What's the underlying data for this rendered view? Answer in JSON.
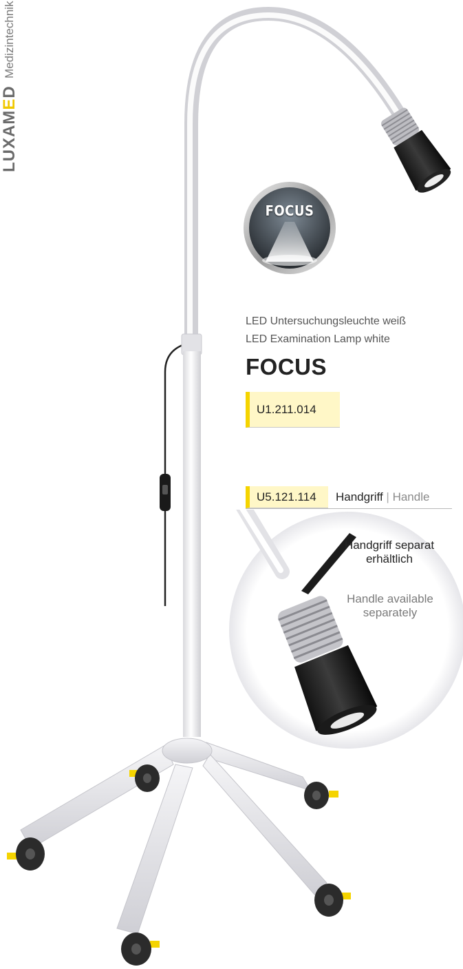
{
  "brand": {
    "logo_main": "LUXAM",
    "logo_accent": "E",
    "logo_tail": "D",
    "tagline": "Medizintechnik Made in Germany"
  },
  "badge": {
    "label": "FOCUS"
  },
  "product": {
    "desc_de": "LED Untersuchungsleuchte weiß",
    "desc_en": "LED Examination Lamp white",
    "name": "FOCUS",
    "code": "U1.211.014"
  },
  "accessory": {
    "code": "U5.121.114",
    "label_de": "Handgriff",
    "separator": " | ",
    "label_en": "Handle",
    "note_de": "Handgriff separat erhältlich",
    "note_en": "Handle available separately"
  },
  "colors": {
    "accent_yellow": "#f5d400",
    "code_bg": "#fff7c7",
    "lamp_white": "#f2f2f4",
    "wheel_dark": "#2b2b2b"
  }
}
